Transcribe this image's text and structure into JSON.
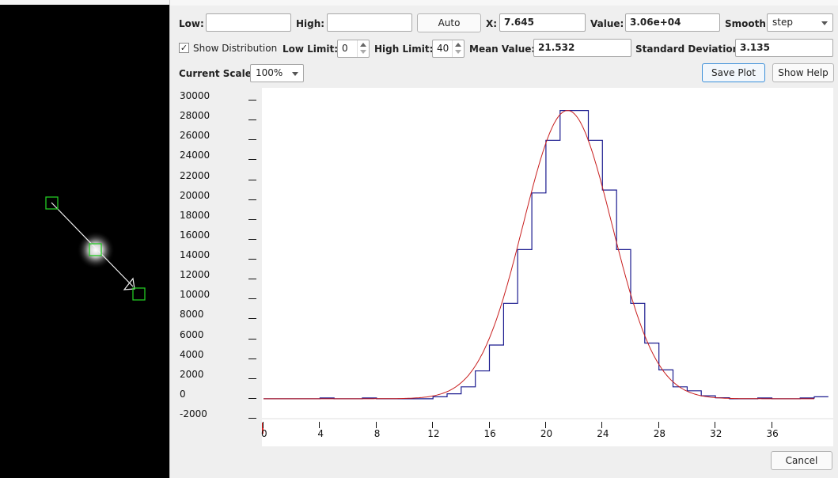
{
  "controls": {
    "low_label": "Low:",
    "low_value": "",
    "high_label": "High:",
    "high_value": "",
    "auto_label": "Auto",
    "x_label": "X:",
    "x_value": "7.645",
    "value_label": "Value:",
    "value_value": "3.06e+04",
    "smooth_label": "Smooth",
    "smooth_value": "step",
    "show_distribution_label": "Show Distribution",
    "show_distribution_checked": true,
    "low_limit_label": "Low Limit:",
    "low_limit_value": "0",
    "high_limit_label": "High Limit:",
    "high_limit_value": "40",
    "mean_label": "Mean Value:",
    "mean_value": "21.532",
    "std_label": "Standard Deviation:",
    "std_value": "3.135",
    "scale_label": "Current Scale:",
    "scale_value": "100%",
    "save_plot_label": "Save Plot",
    "show_help_label": "Show Help",
    "cancel_label": "Cancel"
  },
  "chart_data": {
    "type": "line",
    "title": "",
    "xlabel": "",
    "ylabel": "",
    "xlim": [
      0,
      39
    ],
    "ylim": [
      -2000,
      30000
    ],
    "xticks": [
      0,
      4,
      8,
      12,
      16,
      20,
      24,
      28,
      32,
      36
    ],
    "yticks": [
      30000,
      28000,
      26000,
      24000,
      22000,
      20000,
      18000,
      16000,
      14000,
      12000,
      10000,
      8000,
      6000,
      4000,
      2000,
      0,
      -2000
    ],
    "step_x": [
      0,
      1,
      2,
      3,
      4,
      5,
      6,
      7,
      8,
      9,
      10,
      11,
      12,
      13,
      14,
      15,
      16,
      17,
      18,
      19,
      20,
      21,
      22,
      23,
      24,
      25,
      26,
      27,
      28,
      29,
      30,
      31,
      32,
      33,
      34,
      35,
      36,
      37,
      38,
      39
    ],
    "series": [
      {
        "style": "step",
        "color": "#1b1b8f",
        "values": [
          0,
          0,
          0,
          0,
          80,
          0,
          0,
          80,
          0,
          0,
          0,
          0,
          200,
          500,
          1200,
          2800,
          5400,
          9600,
          15000,
          20700,
          26000,
          29000,
          29000,
          26000,
          21000,
          15000,
          9600,
          5600,
          2900,
          1200,
          800,
          300,
          100,
          0,
          0,
          80,
          0,
          0,
          80,
          200
        ]
      },
      {
        "style": "gaussian-fit",
        "color": "#c81e1e",
        "mean": 21.532,
        "std": 3.135,
        "peak": 29000
      }
    ]
  }
}
